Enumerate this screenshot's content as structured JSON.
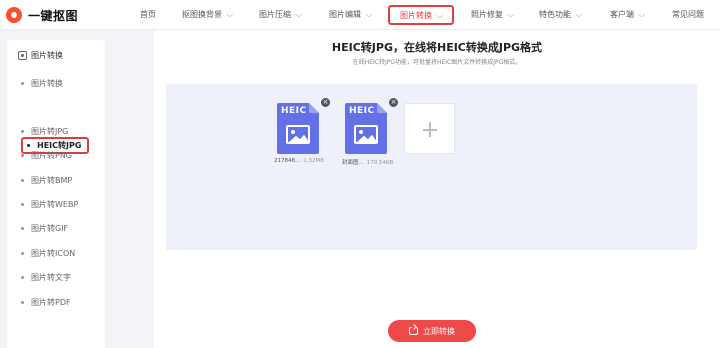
{
  "brand": {
    "name": "一键抠图"
  },
  "nav": [
    {
      "label": "首页",
      "dropdown": false
    },
    {
      "label": "抠图换背景",
      "dropdown": true
    },
    {
      "label": "图片压缩",
      "dropdown": true
    },
    {
      "label": "图片编辑",
      "dropdown": true
    },
    {
      "label": "图片转换",
      "dropdown": true,
      "active": true
    },
    {
      "label": "照片修复",
      "dropdown": true
    },
    {
      "label": "特色功能",
      "dropdown": true
    },
    {
      "label": "客户端",
      "dropdown": true
    },
    {
      "label": "常见问题",
      "dropdown": false
    }
  ],
  "sidebar": {
    "heading": "图片转换",
    "items": [
      {
        "label": "图片转换"
      },
      {
        "label": "HEIC转JPG",
        "active": true
      },
      {
        "label": "图片转JPG"
      },
      {
        "label": "图片转PNG"
      },
      {
        "label": "图片转BMP"
      },
      {
        "label": "图片转WEBP"
      },
      {
        "label": "图片转GIF"
      },
      {
        "label": "图片转ICON"
      },
      {
        "label": "图片转文字"
      },
      {
        "label": "图片转PDF"
      }
    ]
  },
  "main": {
    "title": "HEIC转JPG，在线将HEIC转换成JPG格式",
    "subtitle": "在线HEIC转JPG功能，可批量将HEIC图片文件转换成JPG格式。",
    "files": [
      {
        "badge": "HEIC",
        "name": "217848...",
        "size": "1.32MB"
      },
      {
        "badge": "HEIC",
        "name": "封面图...",
        "size": "170.54KB"
      }
    ],
    "add_icon": "plus-icon",
    "convert_button": "立即转换"
  },
  "colors": {
    "accent": "#ee4a4a",
    "highlight": "#e23d3d",
    "file_icon": "#6471e6",
    "upload_bg": "#eef1f9"
  }
}
